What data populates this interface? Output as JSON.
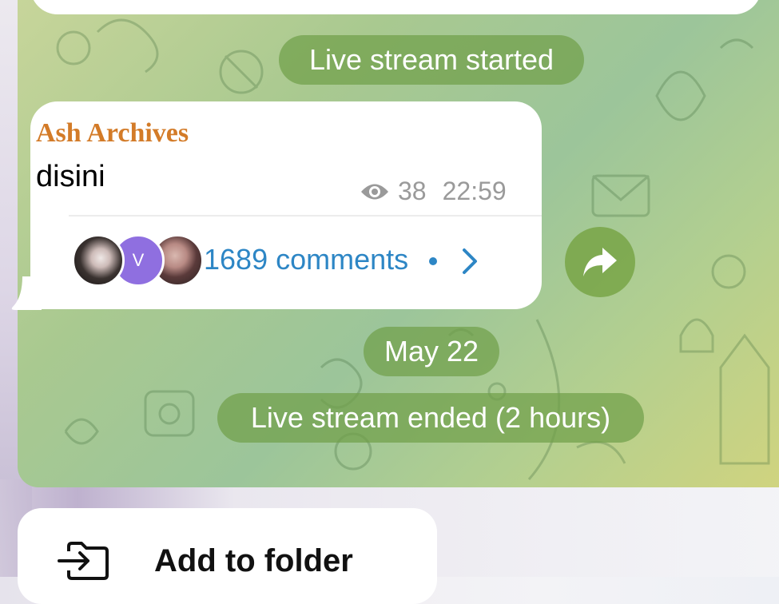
{
  "chat": {
    "service_started": "Live stream started",
    "message": {
      "sender": "Ash Archives",
      "text": "disini",
      "views": "38",
      "time": "22:59",
      "comments": "1689 comments",
      "avatar_initial": "V"
    },
    "date_separator": "May 22",
    "service_ended": "Live stream ended (2 hours)"
  },
  "menu": {
    "add_to_folder": "Add to folder"
  },
  "icons": {
    "views": "eye-icon",
    "comments_arrow": "chevron-right-icon",
    "share": "share-icon",
    "folder": "folder-move-icon"
  },
  "colors": {
    "sender_name": "#d37b28",
    "link": "#2d86c5",
    "service_pill": "#70a04a",
    "avatar_v": "#8f6fe0"
  }
}
